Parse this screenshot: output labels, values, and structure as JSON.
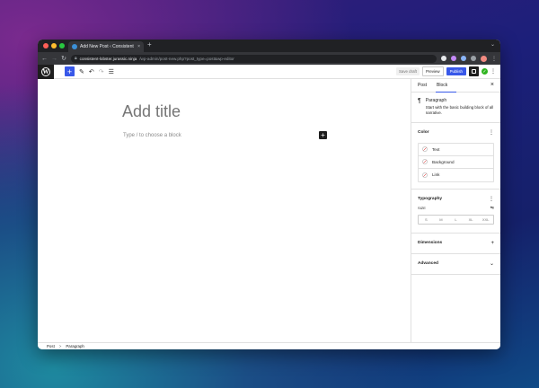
{
  "browser": {
    "tab_title": "Add New Post ‹ Consistent Lo",
    "tab_close": "×",
    "new_tab": "+",
    "url_host": "consistent-lobster.jurassic.ninja",
    "url_path": "/wp-admin/post-new.php?post_type=post&wp-editor",
    "traffic_lights": [
      "#ff5f57",
      "#febc2e",
      "#28c840"
    ]
  },
  "editor_header": {
    "save_draft": "Save draft",
    "preview": "Preview",
    "publish": "Publish",
    "accent": "#3858e9"
  },
  "canvas": {
    "title_placeholder": "Add title",
    "paragraph_placeholder": "Type / to choose a block"
  },
  "sidebar": {
    "tabs": [
      "Post",
      "Block"
    ],
    "active_tab": "Block",
    "block_name": "Paragraph",
    "block_description": "Start with the basic building block of all narrative.",
    "color": {
      "title": "Color",
      "items": [
        "Text",
        "Background",
        "Link"
      ]
    },
    "typography": {
      "title": "Typography",
      "size_label": "SIZE",
      "sizes": [
        "S",
        "M",
        "L",
        "XL",
        "XXL"
      ]
    },
    "dimensions": {
      "title": "Dimensions"
    },
    "advanced": {
      "title": "Advanced"
    }
  },
  "footer": {
    "breadcrumb": [
      "Post",
      "Paragraph"
    ],
    "separator": ">"
  }
}
